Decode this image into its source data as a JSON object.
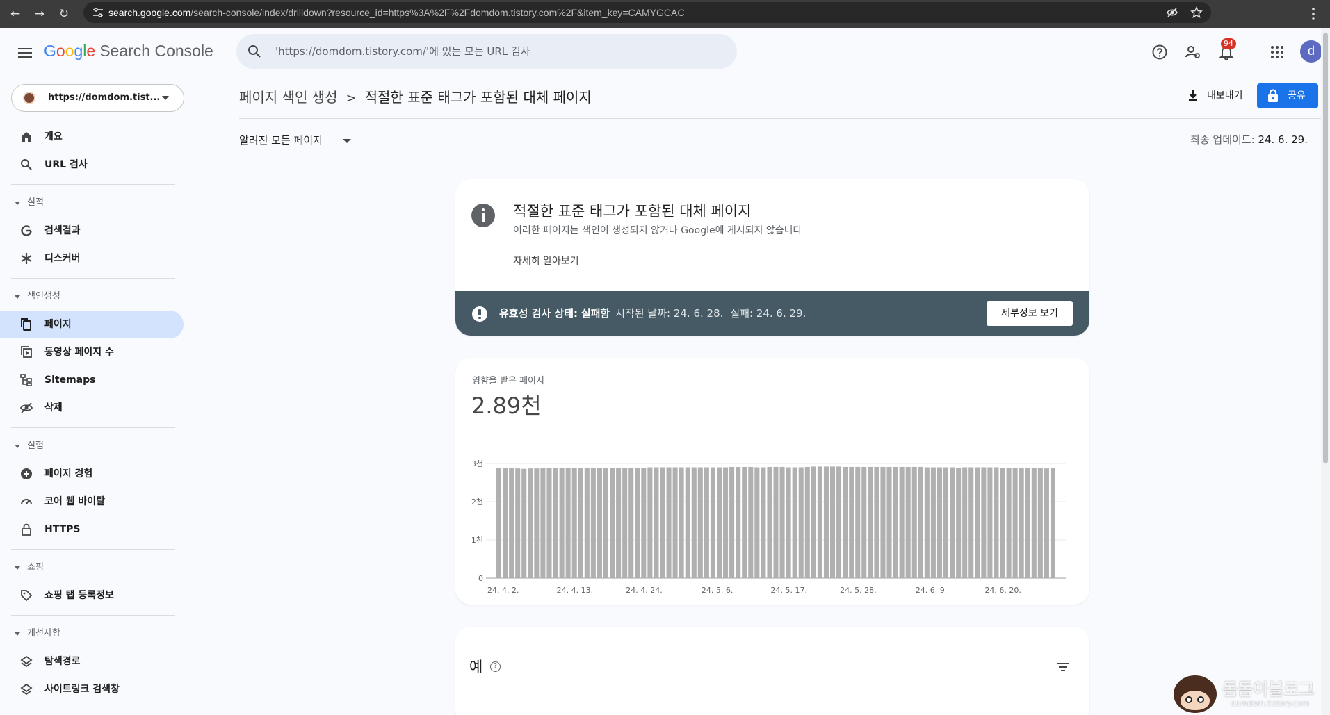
{
  "browser": {
    "url_host": "search.google.com",
    "url_path": "/search-console/index/drilldown?resource_id=https%3A%2F%2Fdomdom.tistory.com%2F&item_key=CAMYGCAC"
  },
  "header": {
    "logo_letters": [
      "G",
      "o",
      "o",
      "g",
      "l",
      "e"
    ],
    "product": "Search Console",
    "search_placeholder": "'https://domdom.tistory.com/'에 있는 모든 URL 검사",
    "notification_count": "94",
    "avatar_letter": "d"
  },
  "sidebar": {
    "property": "https://domdom.tist...",
    "top_items": [
      {
        "label": "개요",
        "icon": "home-icon"
      },
      {
        "label": "URL 검사",
        "icon": "search-icon"
      }
    ],
    "sections": [
      {
        "title": "실적",
        "items": [
          {
            "label": "검색결과",
            "icon": "google-g-icon"
          },
          {
            "label": "디스커버",
            "icon": "asterisk-icon"
          }
        ]
      },
      {
        "title": "색인생성",
        "items": [
          {
            "label": "페이지",
            "icon": "pages-icon",
            "active": true
          },
          {
            "label": "동영상 페이지 수",
            "icon": "video-pages-icon"
          },
          {
            "label": "Sitemaps",
            "icon": "sitemap-icon"
          },
          {
            "label": "삭제",
            "icon": "visibility-off-icon"
          }
        ]
      },
      {
        "title": "실험",
        "items": [
          {
            "label": "페이지 경험",
            "icon": "plus-circle-icon"
          },
          {
            "label": "코어 웹 바이탈",
            "icon": "speed-gauge-icon"
          },
          {
            "label": "HTTPS",
            "icon": "lock-icon"
          }
        ]
      },
      {
        "title": "쇼핑",
        "items": [
          {
            "label": "쇼핑 탭 등록정보",
            "icon": "tag-icon"
          }
        ]
      },
      {
        "title": "개선사항",
        "items": [
          {
            "label": "탐색경로",
            "icon": "layers-icon"
          },
          {
            "label": "사이트링크 검색창",
            "icon": "layers-icon"
          }
        ]
      }
    ]
  },
  "main": {
    "breadcrumb_parent": "페이지 색인 생성",
    "breadcrumb_separator": ">",
    "breadcrumb_current": "적절한 표준 태그가 포함된 대체 페이지",
    "export_label": "내보내기",
    "share_label": "공유",
    "filter_label": "알려진 모든 페이지",
    "last_update_label": "최종 업데이트:",
    "last_update_value": "24. 6. 29."
  },
  "info_card": {
    "title": "적절한 표준 태그가 포함된 대체 페이지",
    "subtitle": "이러한 페이지는 색인이 생성되지 않거나 Google에 게시되지 않습니다",
    "learn_more": "자세히 알아보기",
    "status_label": "유효성 검사 상태:",
    "status_value": "실패함",
    "started": "시작된 날짜: 24. 6. 28.",
    "failed": "실패: 24. 6. 29.",
    "detail_button": "세부정보 보기"
  },
  "chart_card": {
    "label": "영향을 받은 페이지",
    "value": "2.89천"
  },
  "chart_data": {
    "type": "bar",
    "title": "",
    "xlabel": "",
    "ylabel": "",
    "ylim": [
      0,
      3000
    ],
    "y_ticks": [
      {
        "value": 0,
        "label": "0"
      },
      {
        "value": 1000,
        "label": "1천"
      },
      {
        "value": 2000,
        "label": "2천"
      },
      {
        "value": 3000,
        "label": "3천"
      }
    ],
    "x_tick_labels": [
      {
        "index": 0,
        "label": "24. 4. 2."
      },
      {
        "index": 11,
        "label": "24. 4. 13."
      },
      {
        "index": 22,
        "label": "24. 4. 24."
      },
      {
        "index": 34,
        "label": "24. 5. 6."
      },
      {
        "index": 45,
        "label": "24. 5. 17."
      },
      {
        "index": 56,
        "label": "24. 5. 28."
      },
      {
        "index": 68,
        "label": "24. 6. 9."
      },
      {
        "index": 79,
        "label": "24. 6. 20."
      }
    ],
    "bar_color": "#b0b0b0",
    "values": [
      2880,
      2880,
      2880,
      2870,
      2860,
      2870,
      2870,
      2880,
      2880,
      2880,
      2880,
      2880,
      2880,
      2880,
      2880,
      2880,
      2880,
      2880,
      2880,
      2880,
      2880,
      2880,
      2890,
      2890,
      2900,
      2900,
      2900,
      2900,
      2900,
      2900,
      2900,
      2900,
      2900,
      2900,
      2900,
      2900,
      2900,
      2910,
      2910,
      2910,
      2910,
      2900,
      2900,
      2910,
      2910,
      2910,
      2900,
      2900,
      2900,
      2910,
      2920,
      2920,
      2920,
      2920,
      2920,
      2910,
      2910,
      2910,
      2910,
      2910,
      2910,
      2910,
      2910,
      2910,
      2910,
      2910,
      2910,
      2910,
      2900,
      2900,
      2900,
      2900,
      2900,
      2890,
      2900,
      2900,
      2900,
      2900,
      2900,
      2900,
      2890,
      2890,
      2890,
      2890,
      2880,
      2880,
      2880,
      2870,
      2880
    ]
  },
  "examples_card": {
    "title": "예",
    "help": "?"
  },
  "watermark": {
    "text": "돔돔이블로그",
    "sub": "domdom.tistory.com"
  }
}
